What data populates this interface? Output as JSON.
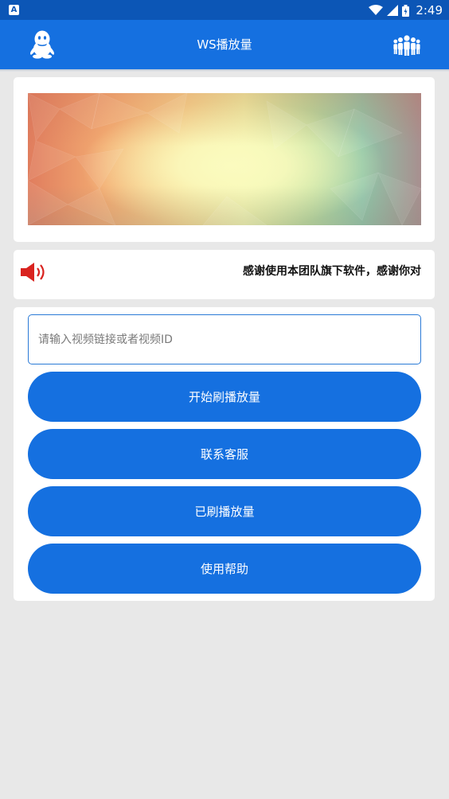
{
  "status_bar": {
    "app_icon_letter": "A",
    "time": "2:49",
    "icons": [
      "wifi-icon",
      "signal-icon",
      "battery-icon"
    ]
  },
  "app_bar": {
    "title": "WS播放量",
    "left_icon": "qq-penguin-icon",
    "right_icon": "group-icon"
  },
  "notice": {
    "text": "感谢使用本团队旗下软件，感谢你对"
  },
  "form": {
    "input_placeholder": "请输入视频链接或者视频ID",
    "input_value": "",
    "buttons": {
      "start": "开始刷播放量",
      "contact": "联系客服",
      "history": "已刷播放量",
      "help": "使用帮助"
    }
  },
  "colors": {
    "primary": "#1570e0",
    "status_bar": "#0c56b6",
    "background": "#e8e8e8",
    "speaker": "#d9231f"
  }
}
